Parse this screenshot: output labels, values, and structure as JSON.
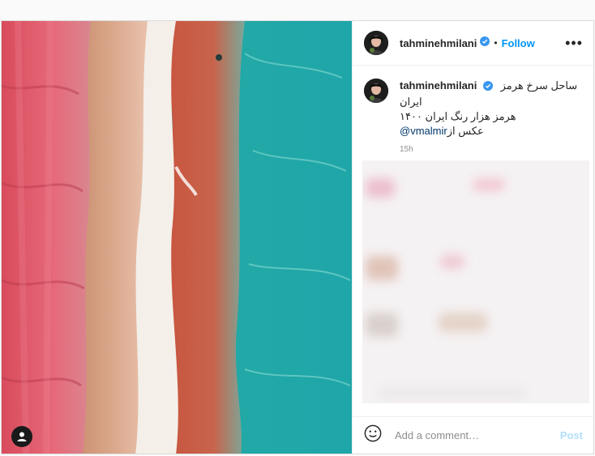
{
  "post": {
    "username": "tahminehmilani",
    "verified": true,
    "follow_separator": "•",
    "follow_label": "Follow",
    "more_label": "•••",
    "caption": {
      "username": "tahminehmilani",
      "line1": "ساحل سرخ هرمز",
      "line2": "ایران",
      "line3": "هرمز هزار رنگ ایران ۱۴۰۰",
      "line4_mention": "@vmalmir",
      "line4_text": " عکس از"
    },
    "timestamp": "15h",
    "comment": {
      "placeholder": "Add a comment…",
      "post_label": "Post"
    },
    "icons": {
      "verified": "verified-badge-icon",
      "more": "more-options-icon",
      "emoji": "emoji-icon",
      "user_tag": "user-tag-icon"
    },
    "colors": {
      "accent": "#0095f6",
      "post_disabled": "#b2dffc",
      "mention": "#00376b"
    }
  }
}
